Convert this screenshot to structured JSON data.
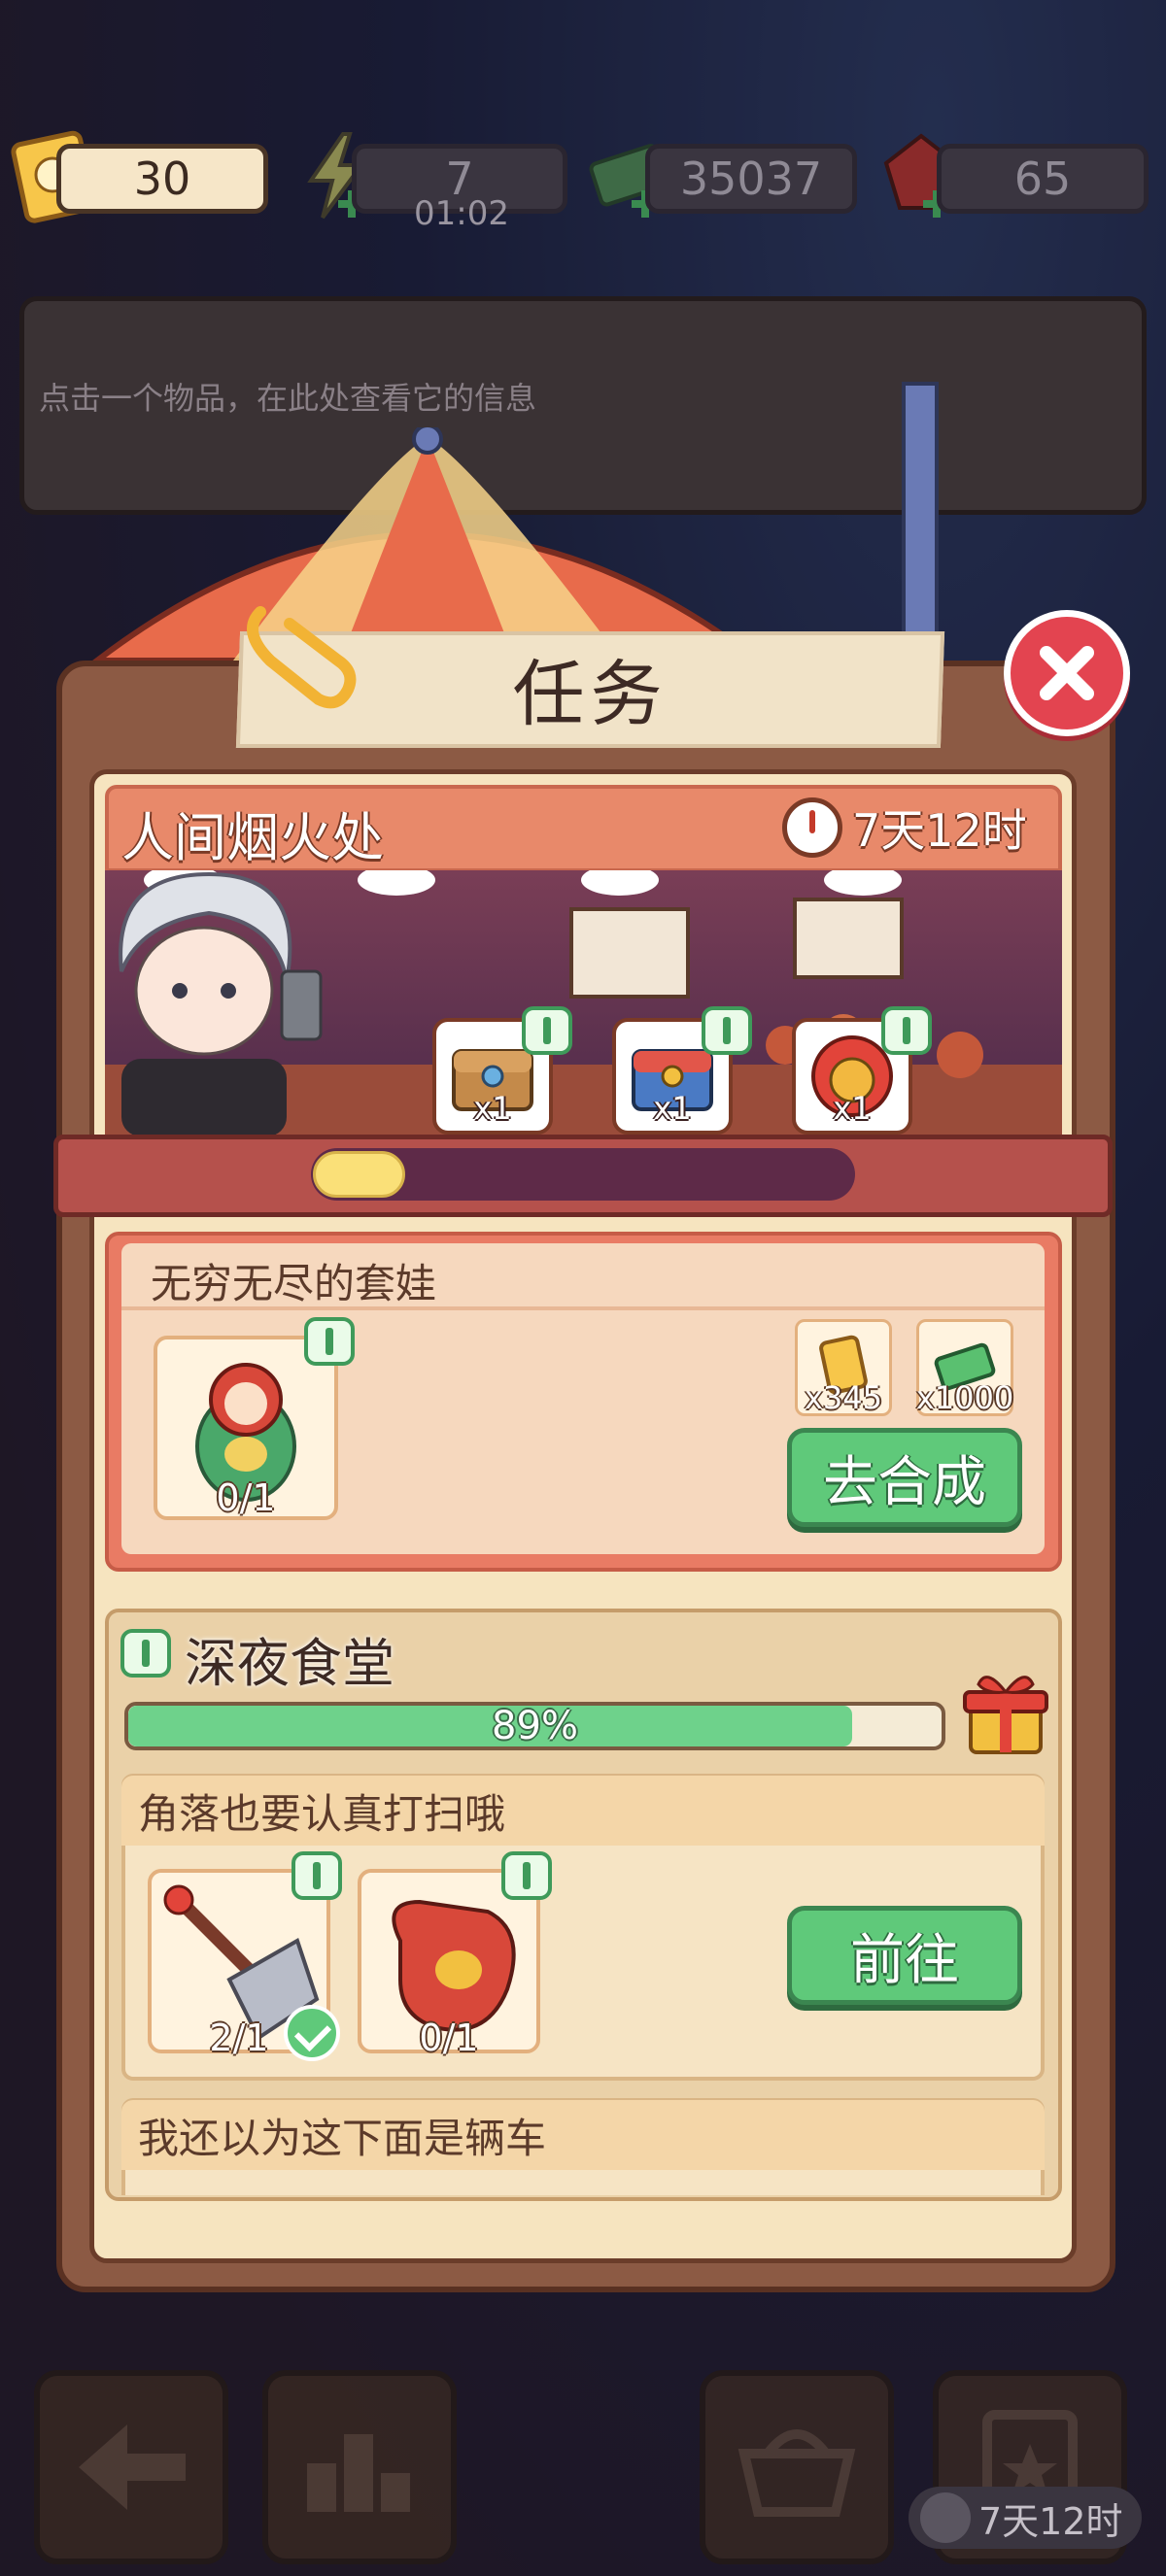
{
  "top_bar": {
    "tickets": "30",
    "energy": "7",
    "energy_timer": "01:02",
    "cash": "35037",
    "gems": "65",
    "icons": [
      "ticket-icon",
      "energy-icon",
      "cash-icon",
      "gem-icon"
    ]
  },
  "info_box": {
    "text": "点击一个物品，在此处查看它的信息"
  },
  "panel": {
    "title": "任务"
  },
  "event": {
    "title": "人间烟火处",
    "time_left": "7天12时",
    "rewards": [
      {
        "icon": "wooden-chest-icon",
        "qty": "x1"
      },
      {
        "icon": "blue-chest-icon",
        "qty": "x1"
      },
      {
        "icon": "red-lion-chest-icon",
        "qty": "x1"
      }
    ],
    "progress_fraction": 0.17
  },
  "task1": {
    "title": "无穷无尽的套娃",
    "item": {
      "icon": "matryoshka-icon",
      "count": "0/1"
    },
    "rewards": [
      {
        "icon": "ticket-icon",
        "qty": "x345"
      },
      {
        "icon": "cash-icon",
        "qty": "x1000"
      }
    ],
    "button": "去合成"
  },
  "chapter": {
    "title": "深夜食堂",
    "percent_label": "89%",
    "percent": 0.89,
    "tasks": [
      {
        "title": "角落也要认真打扫哦",
        "items": [
          {
            "icon": "rake-icon",
            "count": "2/1",
            "done": true
          },
          {
            "icon": "glove-icon",
            "count": "0/1",
            "done": false
          }
        ],
        "button": "前往"
      },
      {
        "title": "我还以为这下面是辆车"
      }
    ]
  },
  "bottom_nav": {
    "timer": "7天12时",
    "buttons": [
      "back-arrow-icon",
      "ranking-icon",
      "basket-icon",
      "clipboard-star-icon"
    ]
  },
  "colors": {
    "accent_green": "#5fc97a",
    "close_red": "#e34450",
    "panel_brown": "#8c5a44"
  }
}
